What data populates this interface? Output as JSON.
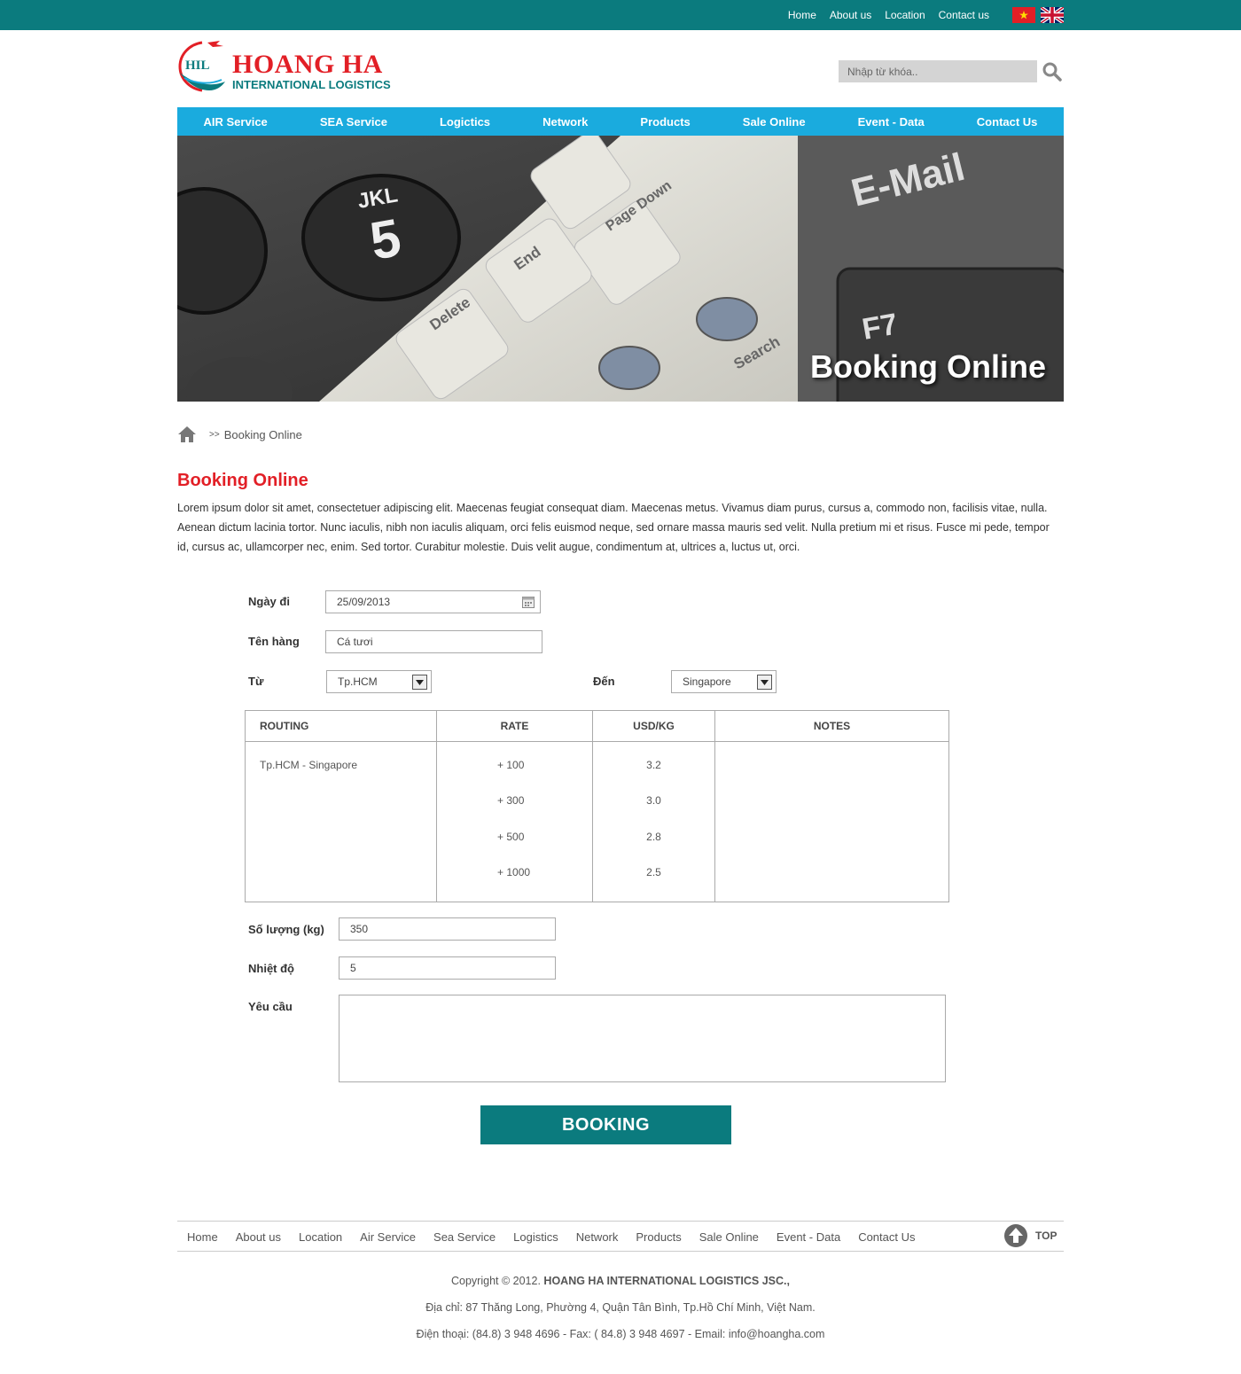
{
  "topbar": {
    "links": [
      "Home",
      "About us",
      "Location",
      "Contact us"
    ],
    "colors": {
      "bar": "#0b7b7e"
    }
  },
  "header": {
    "logo_mark": "HIL",
    "logo_title": "HOANG HA",
    "logo_subtitle": "INTERNATIONAL LOGISTICS",
    "search_placeholder": "Nhập từ khóa.."
  },
  "mainnav": [
    "AIR Service",
    "SEA Service",
    "Logictics",
    "Network",
    "Products",
    "Sale Online",
    "Event - Data",
    "Contact Us"
  ],
  "banner": {
    "title": "Booking Online"
  },
  "breadcrumb": {
    "separator": ">>",
    "current": "Booking Online"
  },
  "page": {
    "title": "Booking Online",
    "intro": "Lorem ipsum dolor sit amet, consectetuer adipiscing elit. Maecenas feugiat consequat diam. Maecenas metus. Vivamus diam purus, cursus a, commodo non, facilisis vitae, nulla. Aenean dictum lacinia tortor. Nunc iaculis, nibh non iaculis aliquam, orci felis euismod neque, sed ornare massa mauris sed velit. Nulla pretium mi et risus. Fusce mi pede, tempor id, cursus ac, ullamcorper nec, enim. Sed tortor. Curabitur molestie. Duis velit augue, condimentum at, ultrices a, luctus ut, orci."
  },
  "form": {
    "date_label": "Ngày đi",
    "date_value": "25/09/2013",
    "goods_label": "Tên hàng",
    "goods_value": "Cá tươi",
    "from_label": "Từ",
    "from_value": "Tp.HCM",
    "to_label": "Đến",
    "to_value": "Singapore",
    "quantity_label": "Số lượng (kg)",
    "quantity_value": "350",
    "temp_label": "Nhiệt độ",
    "temp_value": "5",
    "request_label": "Yêu cầu",
    "request_value": "",
    "submit_label": "BOOKING"
  },
  "rate_table": {
    "headers": [
      "ROUTING",
      "RATE",
      "USD/KG",
      "NOTES"
    ],
    "routing": "Tp.HCM - Singapore",
    "rates": [
      "+ 100",
      "+ 300",
      "+ 500",
      "+ 1000"
    ],
    "usd_per_kg": [
      "3.2",
      "3.0",
      "2.8",
      "2.5"
    ],
    "notes": ""
  },
  "footer": {
    "links": [
      "Home",
      "About us",
      "Location",
      "Air Service",
      "Sea Service",
      "Logistics",
      "Network",
      "Products",
      "Sale Online",
      "Event - Data",
      "Contact Us"
    ],
    "top_label": "TOP",
    "copyright_prefix": "Copyright © 2012.",
    "company": "HOANG HA INTERNATIONAL LOGISTICS JSC.,",
    "address": "Địa chỉ: 87 Thăng Long, Phường 4, Quận Tân Bình, Tp.Hồ Chí Minh, Việt Nam.",
    "contact": "Điện thoại: (84.8) 3 948 4696 - Fax: ( 84.8) 3 948 4697 - Email: info@hoangha.com"
  },
  "colors": {
    "accent_red": "#e21f26",
    "teal": "#0b7b7e",
    "nav_blue": "#1aabde"
  }
}
